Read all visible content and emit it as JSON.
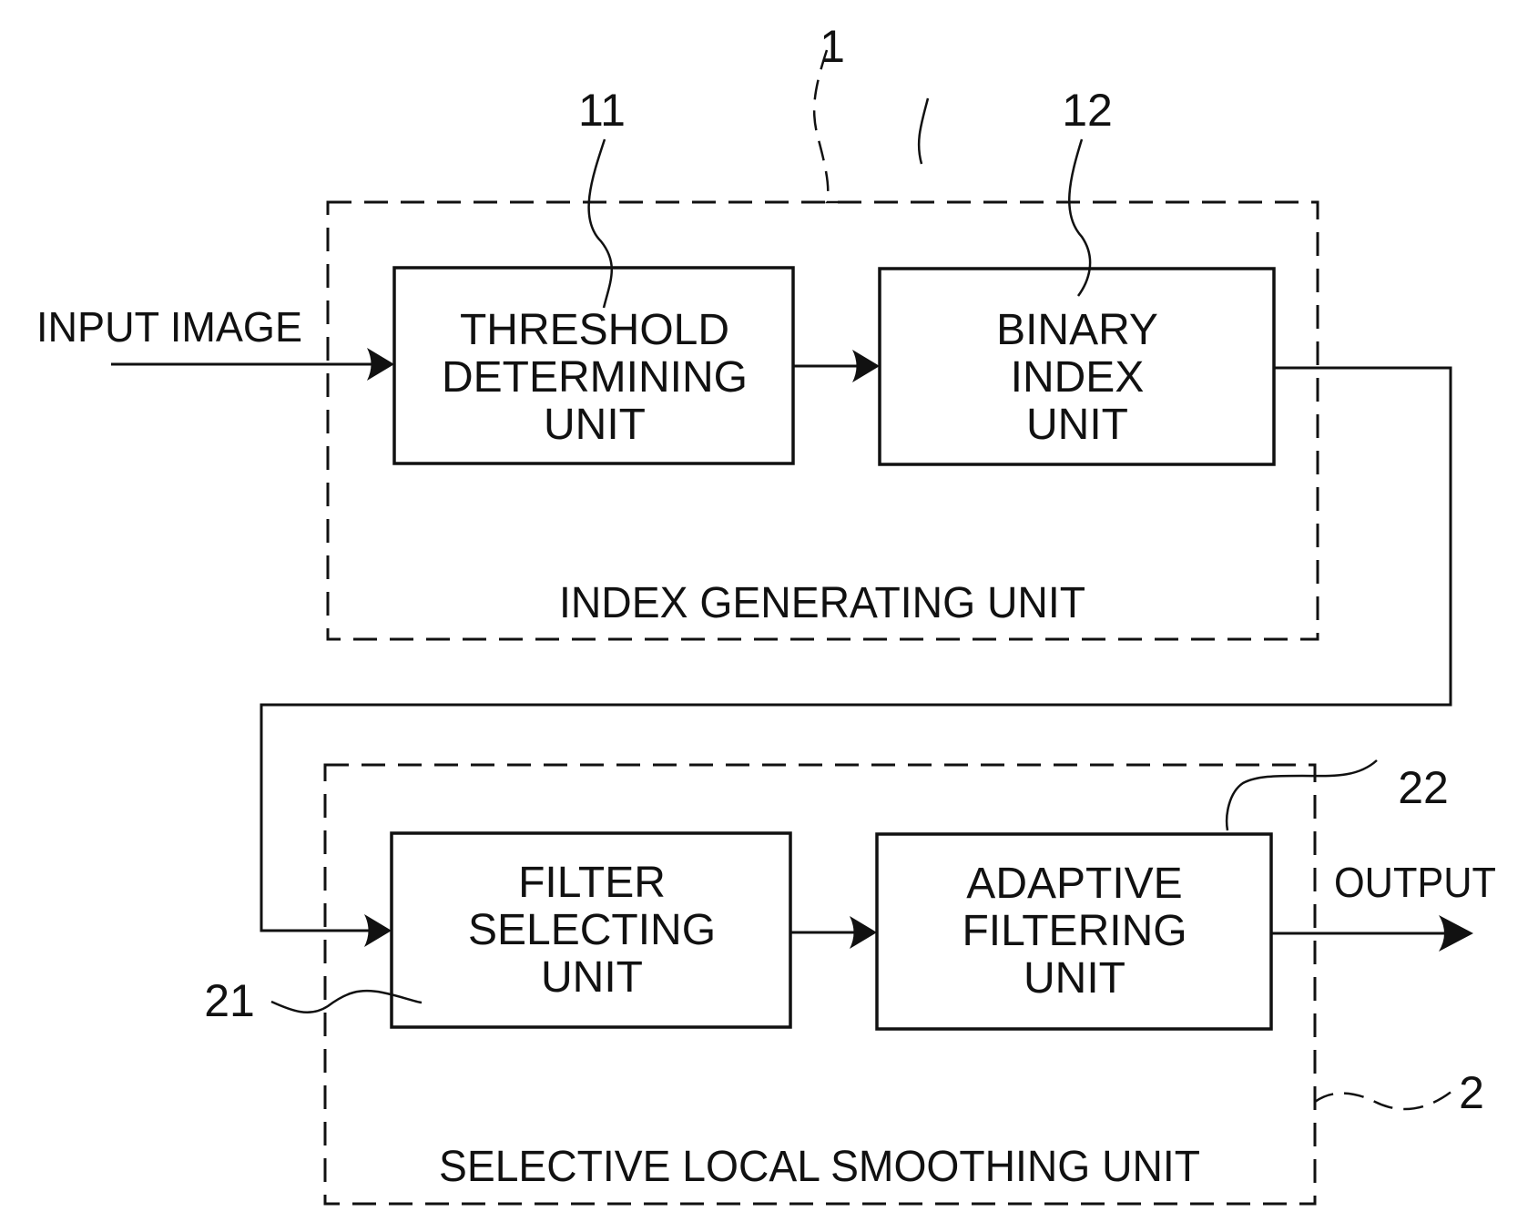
{
  "diagram": {
    "input_label": "INPUT IMAGE",
    "output_label": "OUTPUT",
    "groups": [
      {
        "ref": "1",
        "label": "INDEX GENERATING UNIT"
      },
      {
        "ref": "2",
        "label": "SELECTIVE LOCAL SMOOTHING UNIT"
      }
    ],
    "blocks": [
      {
        "ref": "11",
        "lines": [
          "THRESHOLD",
          "DETERMINING",
          "UNIT"
        ]
      },
      {
        "ref": "12",
        "lines": [
          "BINARY",
          "INDEX",
          "UNIT"
        ]
      },
      {
        "ref": "21",
        "lines": [
          "FILTER",
          "SELECTING",
          "UNIT"
        ]
      },
      {
        "ref": "22",
        "lines": [
          "ADAPTIVE",
          "FILTERING",
          "UNIT"
        ]
      }
    ],
    "connections": [
      {
        "from": "INPUT IMAGE",
        "to": "11"
      },
      {
        "from": "11",
        "to": "12"
      },
      {
        "from": "12",
        "to": "21"
      },
      {
        "from": "21",
        "to": "22"
      },
      {
        "from": "22",
        "to": "OUTPUT"
      }
    ]
  }
}
